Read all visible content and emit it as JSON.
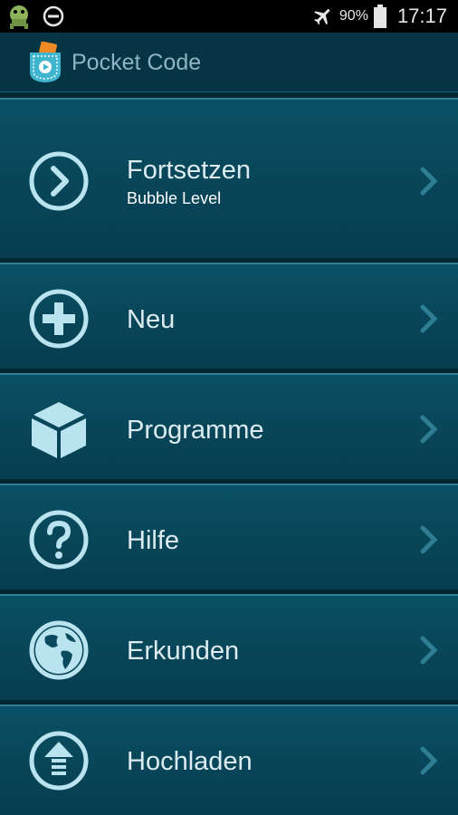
{
  "status_bar": {
    "battery_percent": "90%",
    "time": "17:17",
    "icons": [
      "android-debug-icon",
      "do-not-disturb-icon",
      "airplane-mode-icon",
      "battery-icon"
    ]
  },
  "app_bar": {
    "title": "Pocket Code",
    "logo_icon": "pocket-code-logo-icon"
  },
  "colors": {
    "background": "#05384a",
    "item_top": "#0a5065",
    "icon": "#b9e3ef",
    "label": "#dcebf0",
    "chevron": "#2e7d92"
  },
  "menu": [
    {
      "label": "Fortsetzen",
      "subtitle": "Bubble Level",
      "icon": "continue-arrow-icon"
    },
    {
      "label": "Neu",
      "icon": "plus-circle-icon"
    },
    {
      "label": "Programme",
      "icon": "cube-icon"
    },
    {
      "label": "Hilfe",
      "icon": "help-question-icon"
    },
    {
      "label": "Erkunden",
      "icon": "globe-icon"
    },
    {
      "label": "Hochladen",
      "icon": "upload-icon"
    }
  ]
}
